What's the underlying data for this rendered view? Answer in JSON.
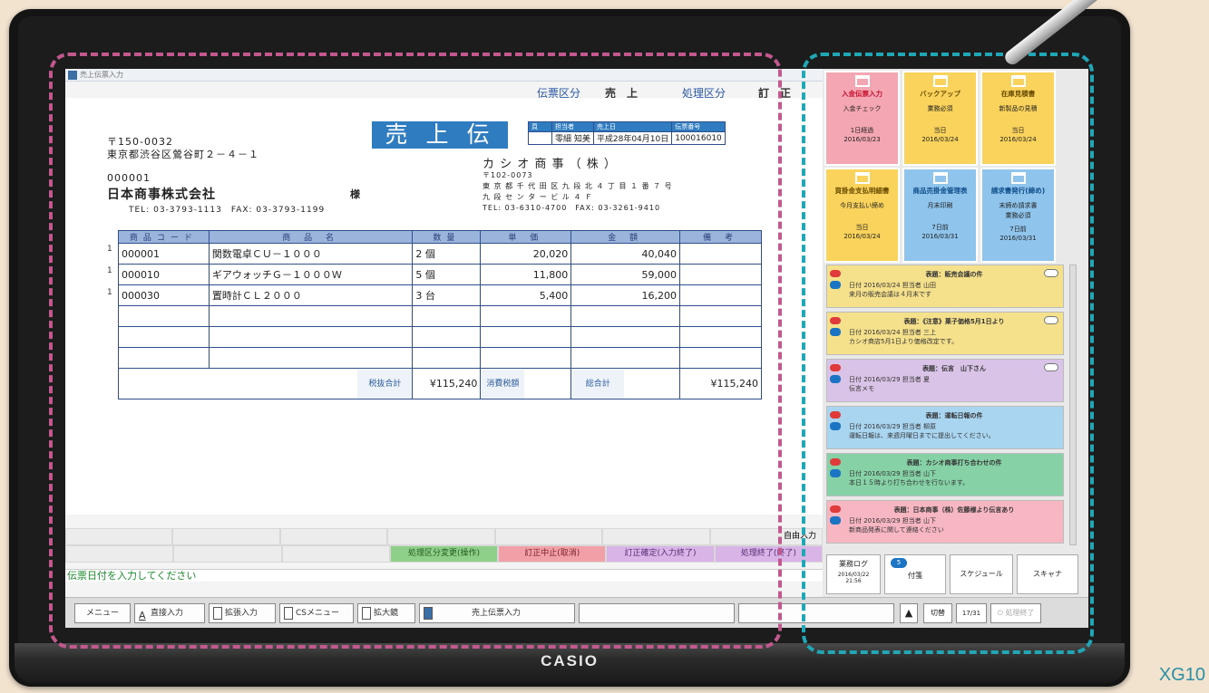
{
  "device": {
    "brand": "CASIO",
    "model": "XG10"
  },
  "window": {
    "title": "売上伝票入力",
    "slip_kind_label": "伝票区分",
    "slip_kind_value": "売　上",
    "process_kind_label": "処理区分",
    "process_kind_value": "訂　正"
  },
  "slip": {
    "postal": "〒150-0032",
    "address": "東京都渋谷区鶯谷町２－４－１",
    "customer_code": "000001",
    "customer_name": "日本商事株式会社",
    "honorific": "様",
    "customer_tel": "TEL: 03-3793-1113　FAX: 03-3793-1199",
    "title": "売 上 伝 票",
    "title_outline": "売 上 伝 票",
    "meta_headers": [
      "頁",
      "担当者",
      "売上日",
      "伝票番号"
    ],
    "meta_values": [
      "",
      "零細 知美",
      "平成28年04月10日",
      "100016010"
    ],
    "issuer_name": "カ シ オ 商 事 （ 株 ）",
    "issuer_postal": "〒102-0073",
    "issuer_address": "東 京 都 千 代 田 区 九 段 北 ４ 丁 目 １ 番 ７ 号",
    "issuer_building": "九 段 セ ン タ ー ビ ル ４ Ｆ",
    "issuer_tel": "TEL: 03-6310-4700　FAX: 03-3261-9410",
    "columns": [
      "商品コード",
      "商 品 名",
      "数量",
      "単 価",
      "金 額",
      "備 考"
    ],
    "rows": [
      {
        "no": "1",
        "code": "000001",
        "name": "関数電卓ＣＵ－１０００",
        "qty": "2 個",
        "price": "20,020",
        "amount": "40,040",
        "note": ""
      },
      {
        "no": "1",
        "code": "000010",
        "name": "ギアウォッチＧ－１０００Ｗ",
        "qty": "5 個",
        "price": "11,800",
        "amount": "59,000",
        "note": ""
      },
      {
        "no": "1",
        "code": "000030",
        "name": "置時計ＣＬ２０００",
        "qty": "3 台",
        "price": "5,400",
        "amount": "16,200",
        "note": ""
      }
    ],
    "subtotal_label": "税抜合計",
    "subtotal": "¥115,240",
    "tax_label": "消費税額",
    "tax": "",
    "total_label": "総合計",
    "total": "¥115,240"
  },
  "function_keys": {
    "free_input": "自由入力",
    "fn1": "処理区分変更(操作)",
    "fn2": "訂正中止(取消)",
    "fn3": "訂正確定(入力終了)",
    "fn4": "処理終了(終了)"
  },
  "message": "伝票日付を入力してください",
  "taskbar": {
    "menu": "メニュー",
    "kana": "直接入力",
    "handwriting": "拡張入力",
    "cs_menu": "CSメニュー",
    "zoom": "拡大鏡",
    "app": "売上伝票入力",
    "switch": "切替",
    "mode": "17/31",
    "shutdown": "処理終了"
  },
  "tiles": [
    {
      "title": "入金伝票入力",
      "line1": "入金チェック",
      "line2": "1日経過",
      "date": "2016/03/23",
      "color": "red"
    },
    {
      "title": "バックアップ",
      "line1": "業務必須",
      "line2": "当日",
      "date": "2016/03/24",
      "color": "yellow"
    },
    {
      "title": "在庫見積書",
      "line1": "新製品の見積",
      "line2": "当日",
      "date": "2016/03/24",
      "color": "yellow"
    },
    {
      "title": "買掛金支払明細書",
      "line1": "今月支払い締め",
      "line2": "当日",
      "date": "2016/03/24",
      "color": "yellow"
    },
    {
      "title": "商品売掛金管理表",
      "line1": "月末印刷",
      "line2": "7日前",
      "date": "2016/03/31",
      "color": "blue"
    },
    {
      "title": "請求書発行(締め)",
      "line1": "末締め請求書",
      "line1b": "業務必須",
      "line2": "7日前",
      "date": "2016/03/31",
      "color": "blue"
    }
  ],
  "notes": [
    {
      "title": "表題：販売会議の件",
      "meta": "日付 2016/03/24 担当者 山田",
      "body": "来月の販売会議は４月末です",
      "color": "yellow"
    },
    {
      "title": "表題：《注意》菓子価格5月1日より",
      "meta": "日付 2016/03/24 担当者 三上",
      "body": "カシオ商店5月1日より価格改定です。",
      "color": "yellow"
    },
    {
      "title": "表題：伝言　山下さん",
      "meta": "日付 2016/03/29 担当者 夏",
      "body": "伝言メモ",
      "color": "purple"
    },
    {
      "title": "表題：運転日報の件",
      "meta": "日付 2016/03/29 担当者 柳原",
      "body": "運転日報は、来週月曜日までに提出してください。",
      "color": "blue"
    },
    {
      "title": "表題：カシオ商事打ち合わせの件",
      "meta": "日付 2016/03/29 担当者 山下",
      "body": "本日１５時より打ち合わせを行ないます。",
      "color": "green"
    },
    {
      "title": "表題：日本商事（株）佐藤様より伝言あり",
      "meta": "日付 2016/03/29 担当者 山下",
      "body": "新商品発表に関して連絡ください",
      "color": "pink"
    }
  ],
  "bottom": {
    "log_label": "業務ログ",
    "log_date": "2016/03/22",
    "log_time": "21:56",
    "sticky": "付箋",
    "sticky_count": "5",
    "schedule": "スケジュール",
    "scanner": "スキャナ"
  }
}
